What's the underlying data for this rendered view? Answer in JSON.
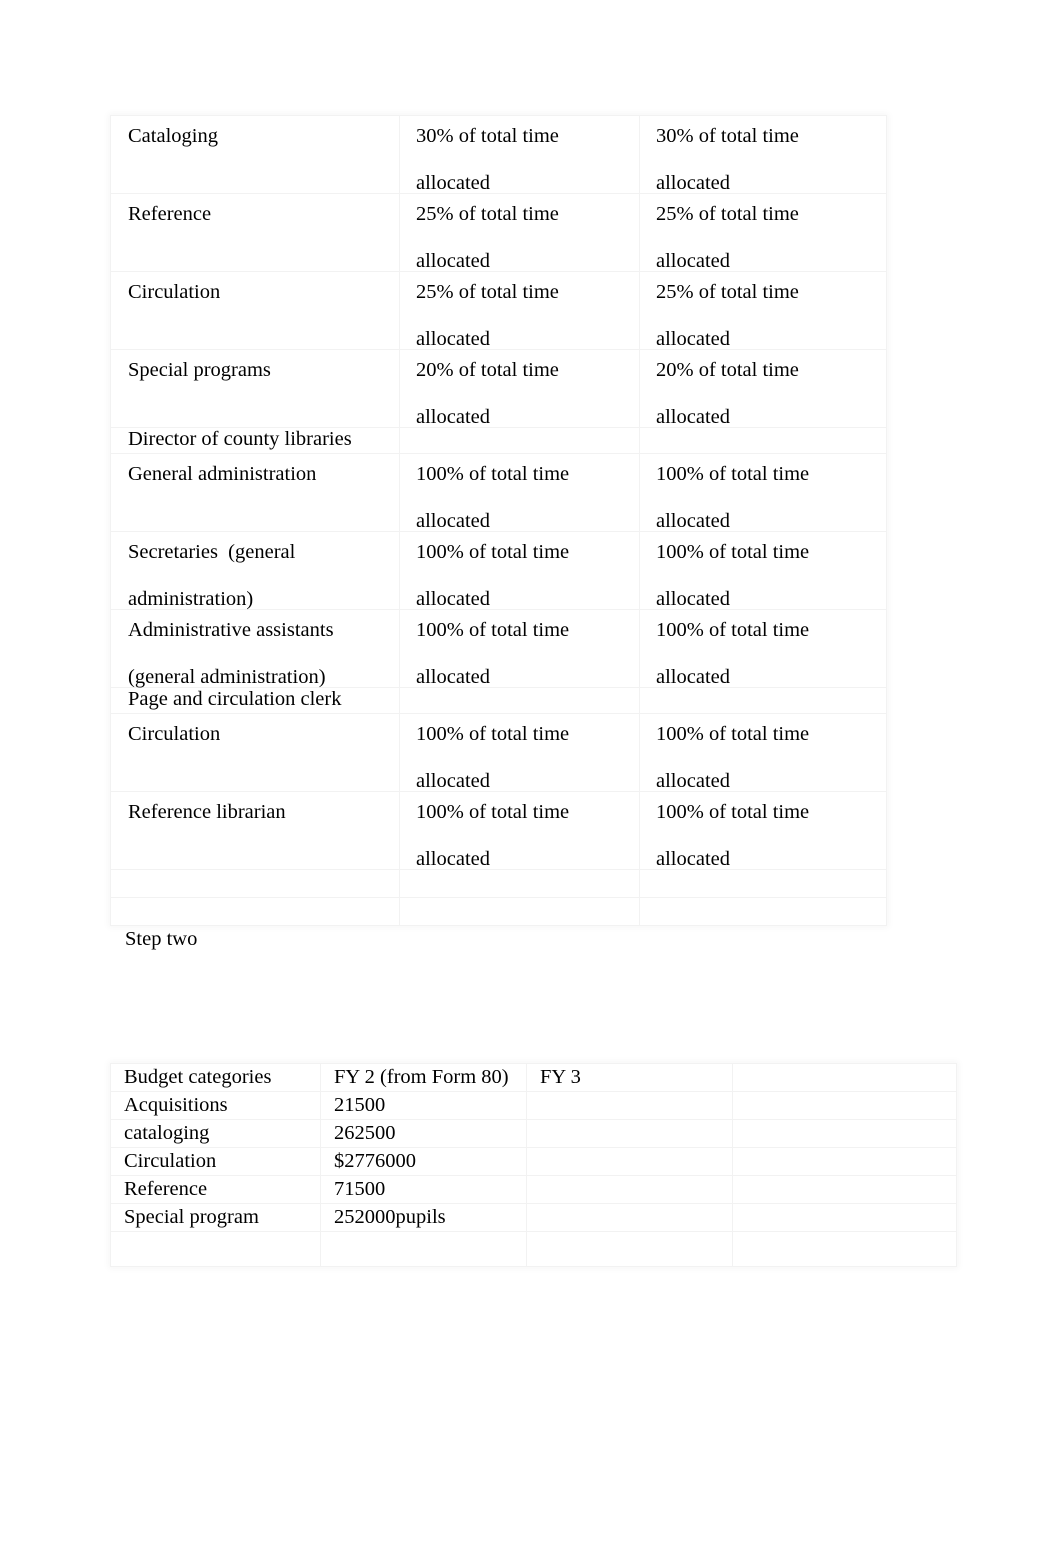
{
  "document": {
    "background_color": "#ffffff",
    "text_color": "#000000",
    "border_color": "#f2f2f2"
  },
  "allocation_table": {
    "name": "staff-time-allocation-table",
    "rows": [
      {
        "type": "data",
        "label": "Cataloging",
        "col2_line1": "30% of total time",
        "col2_line2": "allocated",
        "col3_line1": "30% of total time",
        "col3_line2": "allocated"
      },
      {
        "type": "data",
        "label": "Reference",
        "col2_line1": "25% of total time",
        "col2_line2": "allocated",
        "col3_line1": "25% of total time",
        "col3_line2": "allocated"
      },
      {
        "type": "data",
        "label": "Circulation",
        "col2_line1": "25% of total time",
        "col2_line2": "allocated",
        "col3_line1": "25% of total time",
        "col3_line2": "allocated"
      },
      {
        "type": "data",
        "label": "Special programs",
        "col2_line1": "20% of total time",
        "col2_line2": "allocated",
        "col3_line1": "20% of total time",
        "col3_line2": "allocated"
      },
      {
        "type": "section",
        "label": "Director of county libraries",
        "col2_line1": "",
        "col2_line2": "",
        "col3_line1": "",
        "col3_line2": ""
      },
      {
        "type": "data",
        "label": "General administration",
        "col2_line1": "100% of total time",
        "col2_line2": "allocated",
        "col3_line1": "100% of total time",
        "col3_line2": "allocated"
      },
      {
        "type": "split",
        "label_line1": "Secretaries  (general",
        "label_line2": "administration)",
        "col2_line1": "100% of total time",
        "col2_line2": "allocated",
        "col3_line1": "100% of total time",
        "col3_line2": "allocated"
      },
      {
        "type": "split",
        "label_line1": "Administrative assistants",
        "label_line2": "(general administration)",
        "col2_line1": "100% of total time",
        "col2_line2": "allocated",
        "col3_line1": "100% of total time",
        "col3_line2": "allocated"
      },
      {
        "type": "section",
        "label": "Page and circulation clerk",
        "col2_line1": "",
        "col2_line2": "",
        "col3_line1": "",
        "col3_line2": ""
      },
      {
        "type": "data",
        "label": "Circulation",
        "col2_line1": "100% of total time",
        "col2_line2": "allocated",
        "col3_line1": "100% of total time",
        "col3_line2": "allocated"
      },
      {
        "type": "data",
        "label": "Reference librarian",
        "col2_line1": "100% of total time",
        "col2_line2": "allocated",
        "col3_line1": "100% of total time",
        "col3_line2": "allocated"
      },
      {
        "type": "blank",
        "label": "",
        "col2_line1": "",
        "col2_line2": "",
        "col3_line1": "",
        "col3_line2": ""
      },
      {
        "type": "blank",
        "label": "",
        "col2_line1": "",
        "col2_line2": "",
        "col3_line1": "",
        "col3_line2": ""
      }
    ]
  },
  "step_two_heading": "Step two",
  "budget_table": {
    "name": "budget-categories-table",
    "headers": [
      "Budget categories",
      "FY 2 (from Form 80)",
      "FY 3",
      ""
    ],
    "rows": [
      [
        "Acquisitions",
        "21500",
        "",
        ""
      ],
      [
        "cataloging",
        "262500",
        "",
        ""
      ],
      [
        "Circulation",
        "$2776000",
        "",
        ""
      ],
      [
        "Reference",
        "71500",
        "",
        ""
      ],
      [
        "Special program",
        "252000pupils",
        "",
        ""
      ],
      [
        "",
        "",
        "",
        ""
      ]
    ]
  }
}
